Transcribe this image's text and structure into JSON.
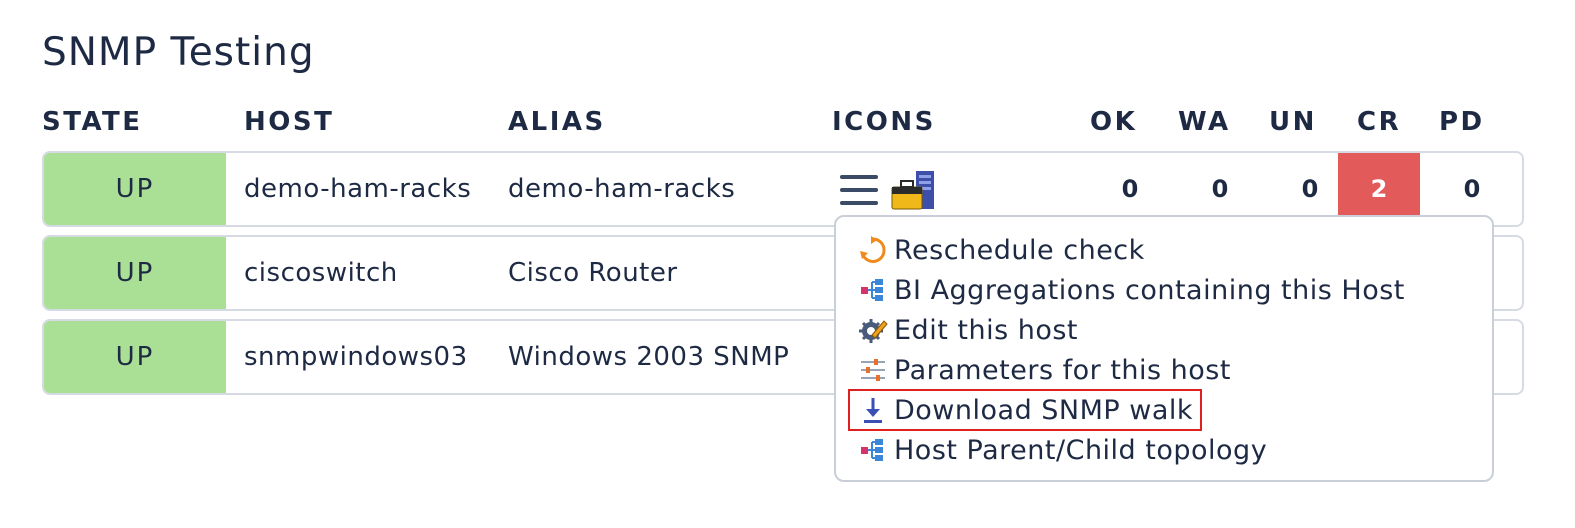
{
  "view": {
    "title": "SNMP Testing"
  },
  "columns": {
    "state": "STATE",
    "host": "HOST",
    "alias": "ALIAS",
    "icons": "ICONS",
    "ok": "OK",
    "wa": "WA",
    "un": "UN",
    "cr": "CR",
    "pd": "PD"
  },
  "rows": [
    {
      "state": "UP",
      "host": "demo-ham-racks",
      "alias": "demo-ham-racks",
      "ok": "0",
      "wa": "0",
      "un": "0",
      "cr": "2",
      "pd": "0"
    },
    {
      "state": "UP",
      "host": "ciscoswitch",
      "alias": "Cisco Router"
    },
    {
      "state": "UP",
      "host": "snmpwindows03",
      "alias": "Windows 2003 SNMP"
    }
  ],
  "colors": {
    "state_up": "#a9e096",
    "critical": "#e25a5a",
    "highlight": "#e02020"
  },
  "icons": {
    "menu": "hamburger-menu-icon",
    "host": "host-toolbox-server-icon"
  },
  "popup": {
    "items": [
      {
        "label": "Reschedule check",
        "icon": "reschedule-icon"
      },
      {
        "label": "BI Aggregations containing this Host",
        "icon": "bi-aggregation-icon"
      },
      {
        "label": "Edit this host",
        "icon": "edit-gear-icon"
      },
      {
        "label": "Parameters for this host",
        "icon": "parameters-icon"
      },
      {
        "label": "Download SNMP walk",
        "icon": "download-icon"
      },
      {
        "label": "Host Parent/Child topology",
        "icon": "topology-icon"
      }
    ]
  }
}
